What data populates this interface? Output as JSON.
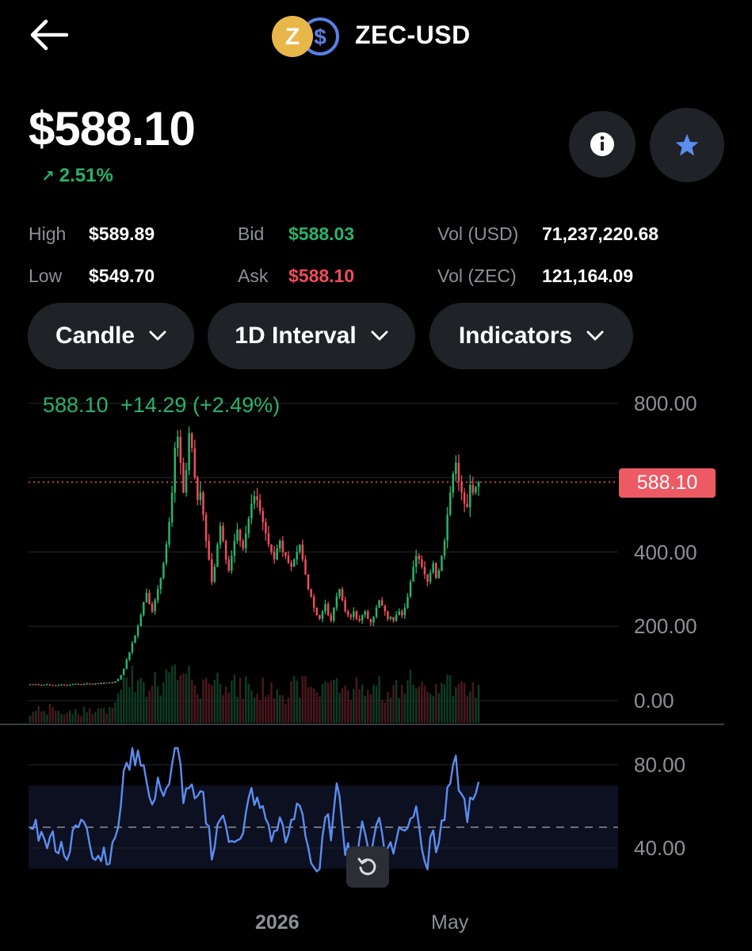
{
  "header": {
    "pair": "ZEC-USD",
    "base_coin_glyph": "Z",
    "quote_coin_glyph": "$",
    "back_icon": "arrow-left-icon",
    "info_icon": "info-icon",
    "star_icon": "star-icon"
  },
  "quote": {
    "price": "$588.10",
    "change": "2.51%",
    "change_icon": "arrow-up-right-icon"
  },
  "stats": {
    "high_label": "High",
    "high_value": "$589.89",
    "low_label": "Low",
    "low_value": "$549.70",
    "bid_label": "Bid",
    "bid_value": "$588.03",
    "ask_label": "Ask",
    "ask_value": "$588.10",
    "vol_usd_label": "Vol (USD)",
    "vol_usd_value": "71,237,220.68",
    "vol_zec_label": "Vol (ZEC)",
    "vol_zec_value": "121,164.09"
  },
  "controls": {
    "chart_type": "Candle",
    "interval": "1D Interval",
    "indicators": "Indicators"
  },
  "colors": {
    "up": "#27b36a",
    "down": "#ee4c5b",
    "rsi": "#5b8def",
    "background": "#000000",
    "button_bg": "#1f2226"
  },
  "chart_data": {
    "type": "candlestick",
    "ohlc_readout": {
      "last": "588.10",
      "change": "+14.29",
      "change_pct": "(+2.49%)"
    },
    "current_price_label": "588.10",
    "price_axis": {
      "ticks": [
        "800.00",
        "400.00",
        "200.00",
        "0.00"
      ],
      "ylim": [
        0,
        800
      ]
    },
    "rsi_axis": {
      "ticks": [
        "80.00",
        "40.00"
      ],
      "band": [
        30,
        70
      ],
      "midline": 50
    },
    "x_labels": [
      "2026",
      "May"
    ],
    "close_series": [
      44,
      43,
      44,
      42,
      41,
      43,
      44,
      42,
      41,
      40,
      42,
      43,
      42,
      41,
      43,
      44,
      45,
      44,
      43,
      45,
      46,
      45,
      44,
      46,
      47,
      46,
      48,
      47,
      49,
      48,
      52,
      58,
      68,
      85,
      110,
      130,
      155,
      175,
      200,
      230,
      265,
      290,
      260,
      240,
      270,
      300,
      330,
      370,
      420,
      480,
      560,
      680,
      710,
      640,
      560,
      620,
      720,
      680,
      600,
      540,
      560,
      500,
      430,
      380,
      320,
      360,
      420,
      470,
      430,
      380,
      350,
      390,
      430,
      460,
      430,
      410,
      450,
      490,
      530,
      550,
      540,
      510,
      480,
      450,
      420,
      400,
      380,
      410,
      430,
      400,
      390,
      370,
      360,
      380,
      400,
      420,
      380,
      340,
      300,
      280,
      250,
      230,
      220,
      240,
      260,
      230,
      215,
      250,
      280,
      300,
      270,
      240,
      230,
      225,
      240,
      220,
      215,
      230,
      240,
      220,
      210,
      225,
      250,
      270,
      255,
      240,
      220,
      225,
      215,
      230,
      240,
      230,
      250,
      280,
      320,
      360,
      390,
      380,
      360,
      340,
      320,
      345,
      370,
      330,
      350,
      390,
      430,
      500,
      560,
      610,
      640,
      590,
      560,
      530,
      520,
      580,
      560,
      575,
      588
    ]
  },
  "reset_icon": "reset-icon"
}
